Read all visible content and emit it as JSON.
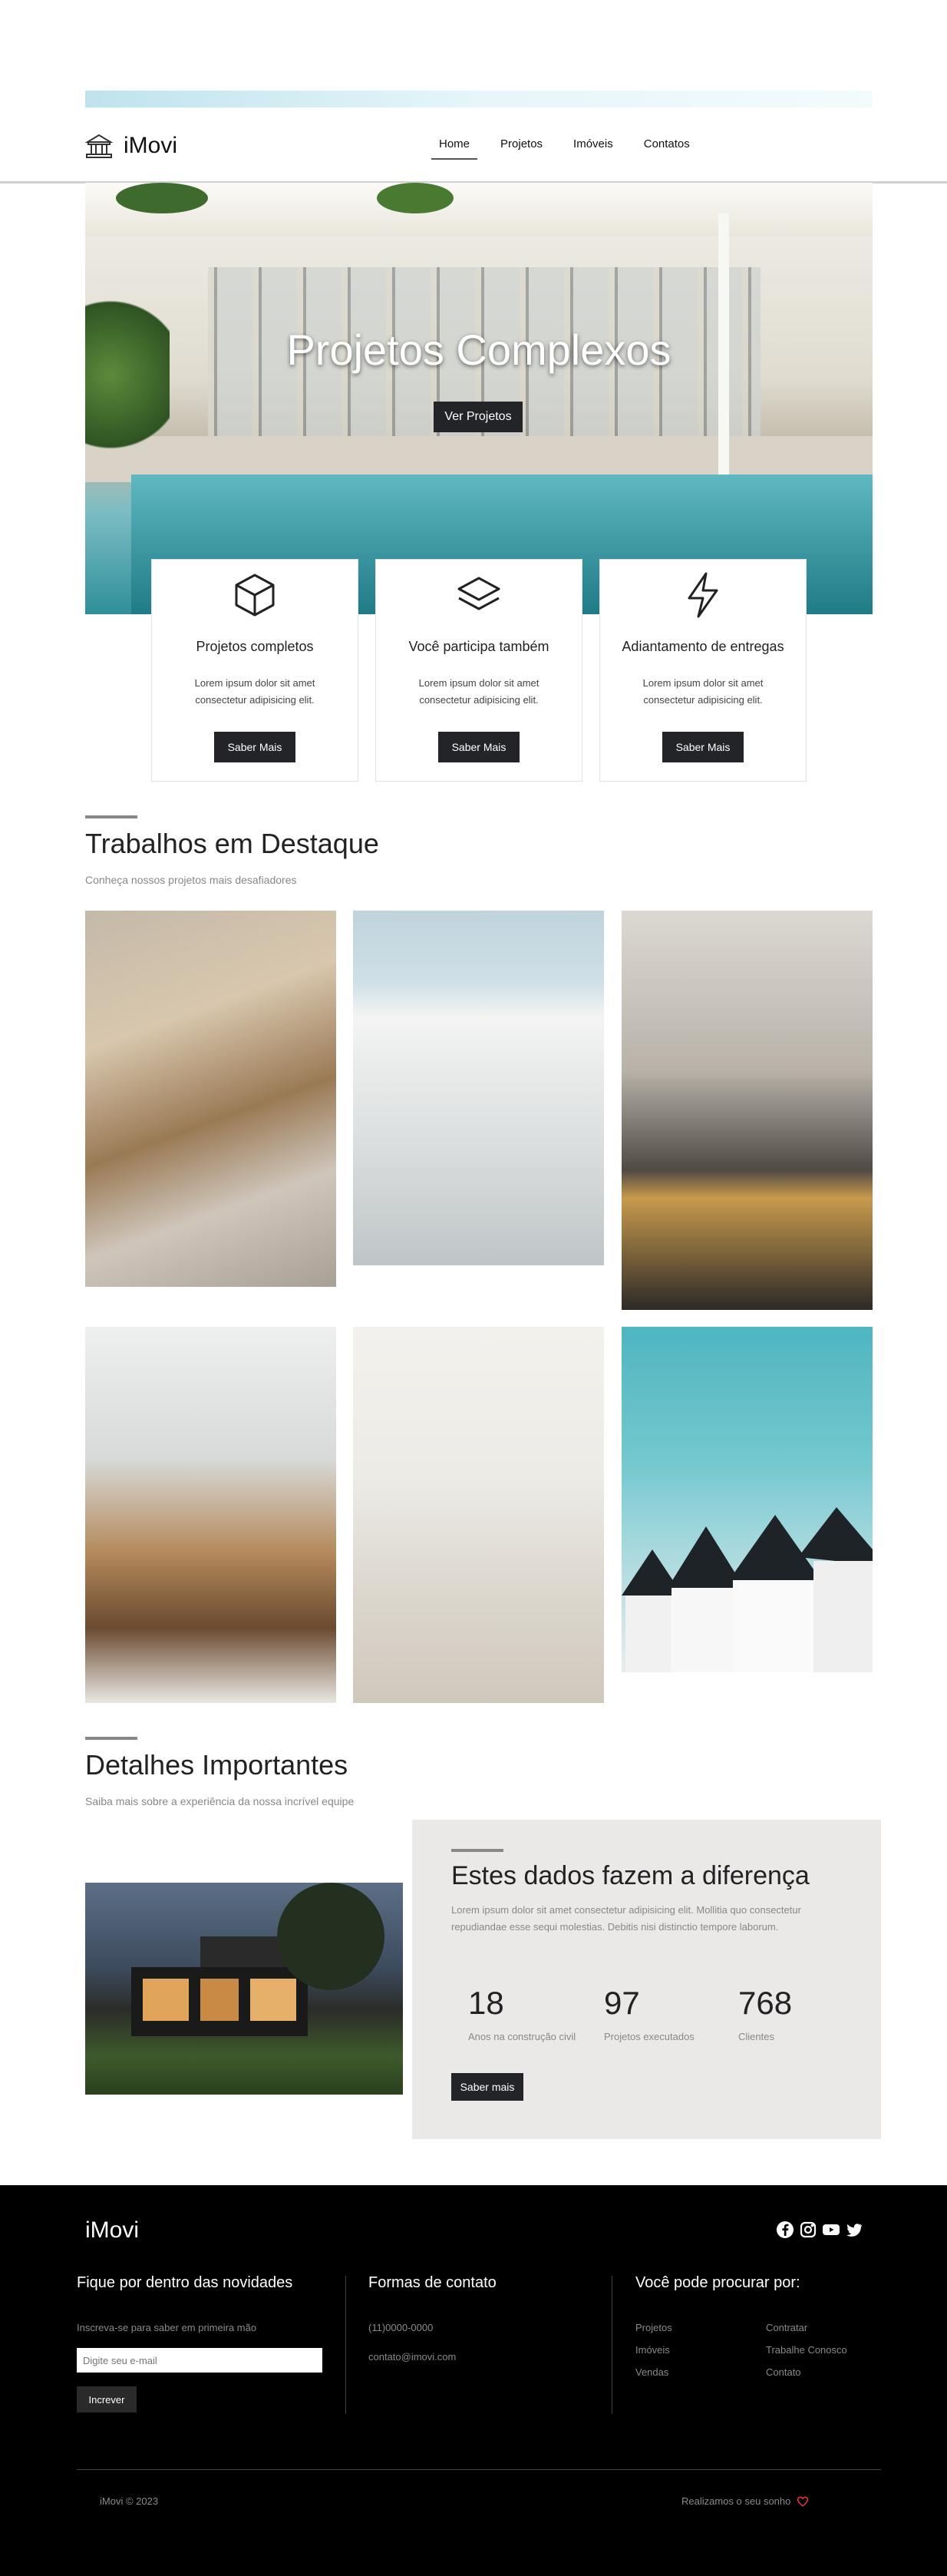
{
  "nav": {
    "brand": "iMovi",
    "items": [
      {
        "label": "Home",
        "active": true
      },
      {
        "label": "Projetos"
      },
      {
        "label": "Imóveis"
      },
      {
        "label": "Contatos"
      }
    ]
  },
  "hero": {
    "title": "Projetos Complexos",
    "button": "Ver Projetos"
  },
  "features": [
    {
      "icon": "cube-icon",
      "title": "Projetos completos",
      "text": "Lorem ipsum dolor sit amet consectetur adipisicing elit.",
      "button": "Saber Mais"
    },
    {
      "icon": "layers-icon",
      "title": "Você participa também",
      "text": "Lorem ipsum dolor sit amet consectetur adipisicing elit.",
      "button": "Saber Mais"
    },
    {
      "icon": "lightning-icon",
      "title": "Adiantamento de entregas",
      "text": "Lorem ipsum dolor sit amet consectetur adipisicing elit.",
      "button": "Saber Mais"
    }
  ],
  "featured": {
    "title": "Trabalhos em Destaque",
    "subtitle": "Conheça nossos projetos mais desafiadores"
  },
  "details": {
    "title": "Detalhes Importantes",
    "subtitle": "Saiba mais sobre a experiência da nossa incrível equipe",
    "panel_title": "Estes dados fazem a diferença",
    "panel_text": "Lorem ipsum dolor sit amet consectetur adipisicing elit. Mollitia quo consectetur repudiandae esse sequi molestias. Debitis nisi distinctio tempore laborum.",
    "stats": [
      {
        "value": "18",
        "label": "Anos na construção civil"
      },
      {
        "value": "97",
        "label": "Projetos executados"
      },
      {
        "value": "768",
        "label": "Clientes"
      }
    ],
    "button": "Saber mais"
  },
  "footer": {
    "brand": "iMovi",
    "social": [
      "facebook-icon",
      "instagram-icon",
      "youtube-icon",
      "twitter-icon"
    ],
    "newsletter_title": "Fique por dentro das novidades",
    "newsletter_text": "Inscreva-se para saber em primeira mão",
    "newsletter_placeholder": "Digite seu e-mail",
    "newsletter_button": "Increver",
    "contact_title": "Formas de contato",
    "phone": "(11)0000-0000",
    "email": "contato@imovi.com",
    "search_title": "Você pode procurar por:",
    "links_col1": [
      "Projetos",
      "Imóveis",
      "Vendas"
    ],
    "links_col2": [
      "Contratar",
      "Trabalhe Conosco",
      "Contato"
    ],
    "copyright": "iMovi © 2023",
    "tagline": "Realizamos o seu sonho",
    "heart_color": "#d33"
  }
}
